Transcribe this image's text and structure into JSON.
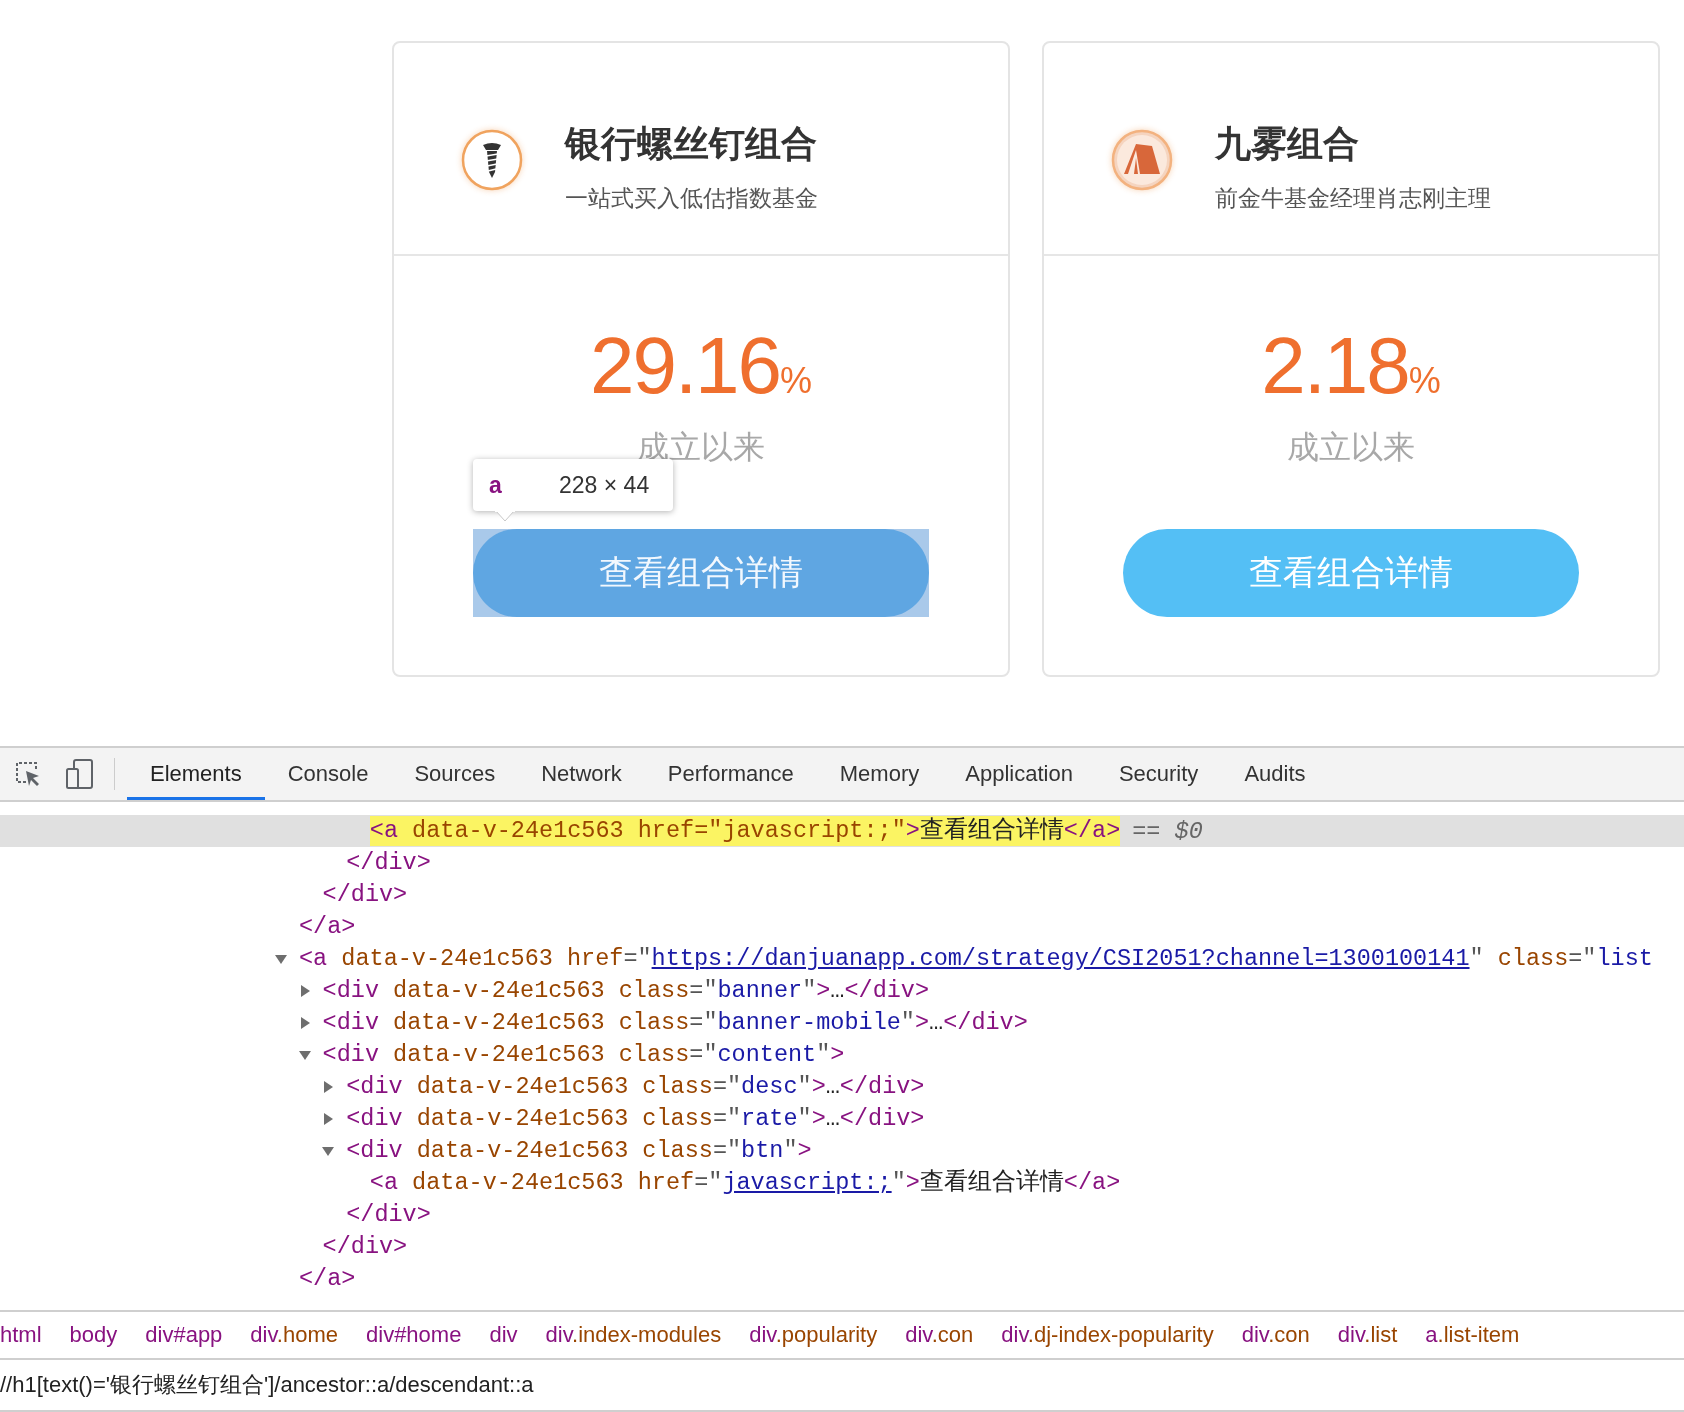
{
  "cards": [
    {
      "title": "银行螺丝钉组合",
      "subtitle": "一站式买入低估指数基金",
      "rate": "29.16",
      "unit": "%",
      "since": "成立以来",
      "button": "查看组合详情",
      "inspected": true
    },
    {
      "title": "九雾组合",
      "subtitle": "前金牛基金经理肖志刚主理",
      "rate": "2.18",
      "unit": "%",
      "since": "成立以来",
      "button": "查看组合详情",
      "inspected": false
    }
  ],
  "inspector_tooltip": {
    "tag": "a",
    "size": "228 × 44"
  },
  "devtools": {
    "tabs": [
      {
        "label": "Elements",
        "selected": true
      },
      {
        "label": "Console",
        "selected": false
      },
      {
        "label": "Sources",
        "selected": false
      },
      {
        "label": "Network",
        "selected": false
      },
      {
        "label": "Performance",
        "selected": false
      },
      {
        "label": "Memory",
        "selected": false
      },
      {
        "label": "Application",
        "selected": false
      },
      {
        "label": "Security",
        "selected": false
      },
      {
        "label": "Audits",
        "selected": false
      }
    ],
    "selected_marker": "== $0",
    "tree": [
      {
        "selected": false,
        "close": [
          {
            "kind": "tag",
            "text": "</a>"
          }
        ],
        "children": [
          {
            "selected": false,
            "close": [
              {
                "kind": "tag",
                "text": "</div>"
              }
            ],
            "children": [
              {
                "selected": false,
                "close": [
                  {
                    "kind": "tag",
                    "text": "</div>"
                  }
                ],
                "children": [
                  {
                    "selected": true,
                    "open": [
                      {
                        "kind": "tag",
                        "text": "<a"
                      },
                      {
                        "kind": "attr",
                        "text": " data-v-24e1c563"
                      },
                      {
                        "kind": "attr",
                        "text": " href"
                      },
                      {
                        "kind": "punct",
                        "text": "=\""
                      },
                      {
                        "kind": "value",
                        "text": "javascript:;"
                      },
                      {
                        "kind": "punct",
                        "text": "\""
                      },
                      {
                        "kind": "tag",
                        "text": ">"
                      },
                      {
                        "kind": "text",
                        "text": "查看组合详情"
                      },
                      {
                        "kind": "tag",
                        "text": "</a>"
                      }
                    ]
                  }
                ]
              }
            ]
          }
        ]
      },
      {
        "selected": false,
        "expanded": true,
        "open": [
          {
            "kind": "tag",
            "text": "<a"
          },
          {
            "kind": "attr",
            "text": " data-v-24e1c563"
          },
          {
            "kind": "attr",
            "text": " href"
          },
          {
            "kind": "punct",
            "text": "=\""
          },
          {
            "kind": "link",
            "text": "https://danjuanapp.com/strategy/CSI2051?channel=1300100141"
          },
          {
            "kind": "punct",
            "text": "\""
          },
          {
            "kind": "attr",
            "text": " class"
          },
          {
            "kind": "punct",
            "text": "=\""
          },
          {
            "kind": "value",
            "text": "list"
          }
        ],
        "close": [
          {
            "kind": "tag",
            "text": "</a>"
          }
        ],
        "children": [
          {
            "selected": false,
            "expanded": false,
            "open": [
              {
                "kind": "tag",
                "text": "<div"
              },
              {
                "kind": "attr",
                "text": " data-v-24e1c563"
              },
              {
                "kind": "attr",
                "text": " class"
              },
              {
                "kind": "punct",
                "text": "=\""
              },
              {
                "kind": "value",
                "text": "banner"
              },
              {
                "kind": "punct",
                "text": "\""
              },
              {
                "kind": "tag",
                "text": ">"
              },
              {
                "kind": "text",
                "text": "…"
              },
              {
                "kind": "tag",
                "text": "</div>"
              }
            ]
          },
          {
            "selected": false,
            "expanded": false,
            "open": [
              {
                "kind": "tag",
                "text": "<div"
              },
              {
                "kind": "attr",
                "text": " data-v-24e1c563"
              },
              {
                "kind": "attr",
                "text": " class"
              },
              {
                "kind": "punct",
                "text": "=\""
              },
              {
                "kind": "value",
                "text": "banner-mobile"
              },
              {
                "kind": "punct",
                "text": "\""
              },
              {
                "kind": "tag",
                "text": ">"
              },
              {
                "kind": "text",
                "text": "…"
              },
              {
                "kind": "tag",
                "text": "</div>"
              }
            ]
          },
          {
            "selected": false,
            "expanded": true,
            "open": [
              {
                "kind": "tag",
                "text": "<div"
              },
              {
                "kind": "attr",
                "text": " data-v-24e1c563"
              },
              {
                "kind": "attr",
                "text": " class"
              },
              {
                "kind": "punct",
                "text": "=\""
              },
              {
                "kind": "value",
                "text": "content"
              },
              {
                "kind": "punct",
                "text": "\""
              },
              {
                "kind": "tag",
                "text": ">"
              }
            ],
            "close": [
              {
                "kind": "tag",
                "text": "</div>"
              }
            ],
            "children": [
              {
                "selected": false,
                "expanded": false,
                "open": [
                  {
                    "kind": "tag",
                    "text": "<div"
                  },
                  {
                    "kind": "attr",
                    "text": " data-v-24e1c563"
                  },
                  {
                    "kind": "attr",
                    "text": " class"
                  },
                  {
                    "kind": "punct",
                    "text": "=\""
                  },
                  {
                    "kind": "value",
                    "text": "desc"
                  },
                  {
                    "kind": "punct",
                    "text": "\""
                  },
                  {
                    "kind": "tag",
                    "text": ">"
                  },
                  {
                    "kind": "text",
                    "text": "…"
                  },
                  {
                    "kind": "tag",
                    "text": "</div>"
                  }
                ]
              },
              {
                "selected": false,
                "expanded": false,
                "open": [
                  {
                    "kind": "tag",
                    "text": "<div"
                  },
                  {
                    "kind": "attr",
                    "text": " data-v-24e1c563"
                  },
                  {
                    "kind": "attr",
                    "text": " class"
                  },
                  {
                    "kind": "punct",
                    "text": "=\""
                  },
                  {
                    "kind": "value",
                    "text": "rate"
                  },
                  {
                    "kind": "punct",
                    "text": "\""
                  },
                  {
                    "kind": "tag",
                    "text": ">"
                  },
                  {
                    "kind": "text",
                    "text": "…"
                  },
                  {
                    "kind": "tag",
                    "text": "</div>"
                  }
                ]
              },
              {
                "selected": false,
                "expanded": true,
                "open": [
                  {
                    "kind": "tag",
                    "text": "<div"
                  },
                  {
                    "kind": "attr",
                    "text": " data-v-24e1c563"
                  },
                  {
                    "kind": "attr",
                    "text": " class"
                  },
                  {
                    "kind": "punct",
                    "text": "=\""
                  },
                  {
                    "kind": "value",
                    "text": "btn"
                  },
                  {
                    "kind": "punct",
                    "text": "\""
                  },
                  {
                    "kind": "tag",
                    "text": ">"
                  }
                ],
                "close": [
                  {
                    "kind": "tag",
                    "text": "</div>"
                  }
                ],
                "children": [
                  {
                    "selected": false,
                    "open": [
                      {
                        "kind": "tag",
                        "text": "<a"
                      },
                      {
                        "kind": "attr",
                        "text": " data-v-24e1c563"
                      },
                      {
                        "kind": "attr",
                        "text": " href"
                      },
                      {
                        "kind": "punct",
                        "text": "=\""
                      },
                      {
                        "kind": "link",
                        "text": "javascript:;"
                      },
                      {
                        "kind": "punct",
                        "text": "\""
                      },
                      {
                        "kind": "tag",
                        "text": ">"
                      },
                      {
                        "kind": "text",
                        "text": "查看组合详情"
                      },
                      {
                        "kind": "tag",
                        "text": "</a>"
                      }
                    ]
                  }
                ]
              }
            ]
          }
        ]
      }
    ],
    "breadcrumbs": [
      "html",
      "body",
      "div#app",
      "div.home",
      "div#home",
      "div",
      "div.index-modules",
      "div.popularity",
      "div.con",
      "div.dj-index-popularity",
      "div.con",
      "div.list",
      "a.list-item"
    ],
    "search": {
      "value": "//h1[text()='银行螺丝钉组合']/ancestor::a/descendant::a"
    }
  }
}
